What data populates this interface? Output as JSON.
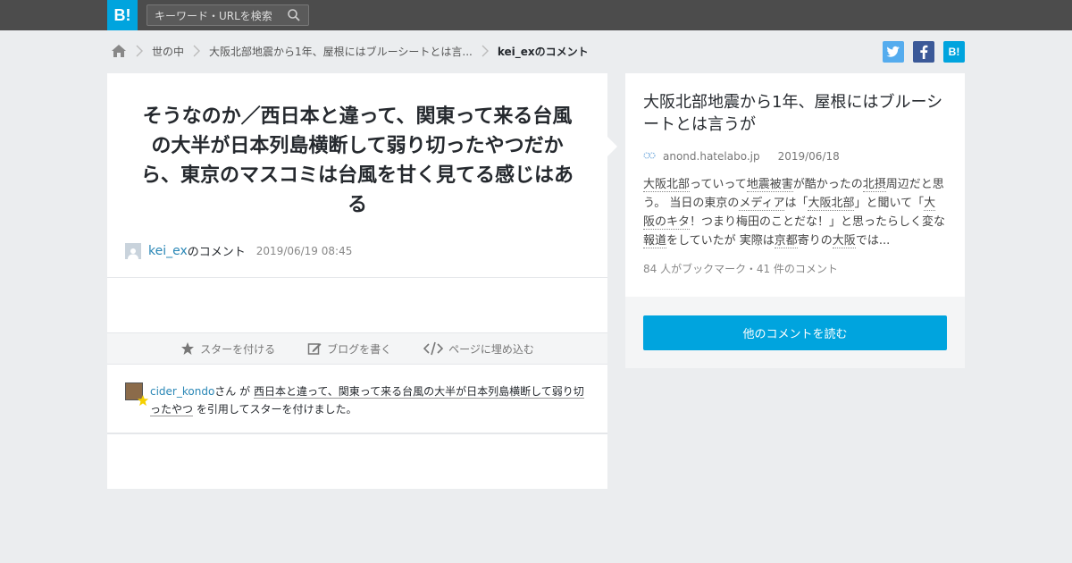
{
  "header": {
    "logo": "B!",
    "search_placeholder": "キーワード・URLを検索"
  },
  "breadcrumb": {
    "items": [
      {
        "label": "世の中"
      },
      {
        "label": "大阪北部地震から1年、屋根にはブルーシートとは言..."
      },
      {
        "label": "kei_exのコメント"
      }
    ]
  },
  "share": {
    "twitter": "t",
    "facebook": "f",
    "hatena": "B!"
  },
  "comment": {
    "text": "そうなのか／西日本と違って、関東って来る台風の大半が日本列島横断して弱り切ったやつだから、東京のマスコミは台風を甘く見てる感じはある",
    "user": "kei_ex",
    "suffix": "のコメント",
    "date": "2019/06/19 08:45"
  },
  "actions": {
    "star": "スターを付ける",
    "blog": "ブログを書く",
    "embed": "ページに埋め込む"
  },
  "star_notice": {
    "user": "cider_kondo",
    "san": "さん が",
    "quote": "西日本と違って、関東って来る台風の大半が日本列島横断して弱り切ったやつ",
    "tail": "を引用してスターを付けました。"
  },
  "entry": {
    "title": "大阪北部地震から1年、屋根にはブルーシートとは言うが",
    "domain": "anond.hatelabo.jp",
    "date": "2019/06/18",
    "body": [
      {
        "t": "大阪北部",
        "k": true
      },
      {
        "t": "っていって",
        "k": false
      },
      {
        "t": "地震被害",
        "k": true
      },
      {
        "t": "が酷かったの",
        "k": false
      },
      {
        "t": "北摂",
        "k": true
      },
      {
        "t": "周辺だと思う。 当日の東京の",
        "k": false
      },
      {
        "t": "メディア",
        "k": true
      },
      {
        "t": "は「",
        "k": false
      },
      {
        "t": "大阪北部",
        "k": true
      },
      {
        "t": "」と聞いて「",
        "k": false
      },
      {
        "t": "大阪のキタ",
        "k": true
      },
      {
        "t": "！つまり梅田のことだな！」と思ったらしく変な",
        "k": false
      },
      {
        "t": "報道",
        "k": true
      },
      {
        "t": "をしていたが 実際は",
        "k": false
      },
      {
        "t": "京都",
        "k": true
      },
      {
        "t": "寄りの",
        "k": false
      },
      {
        "t": "大阪",
        "k": true
      },
      {
        "t": "では...",
        "k": false
      }
    ],
    "count": "84 人がブックマーク・41 件のコメント",
    "read_more": "他のコメントを読む"
  }
}
